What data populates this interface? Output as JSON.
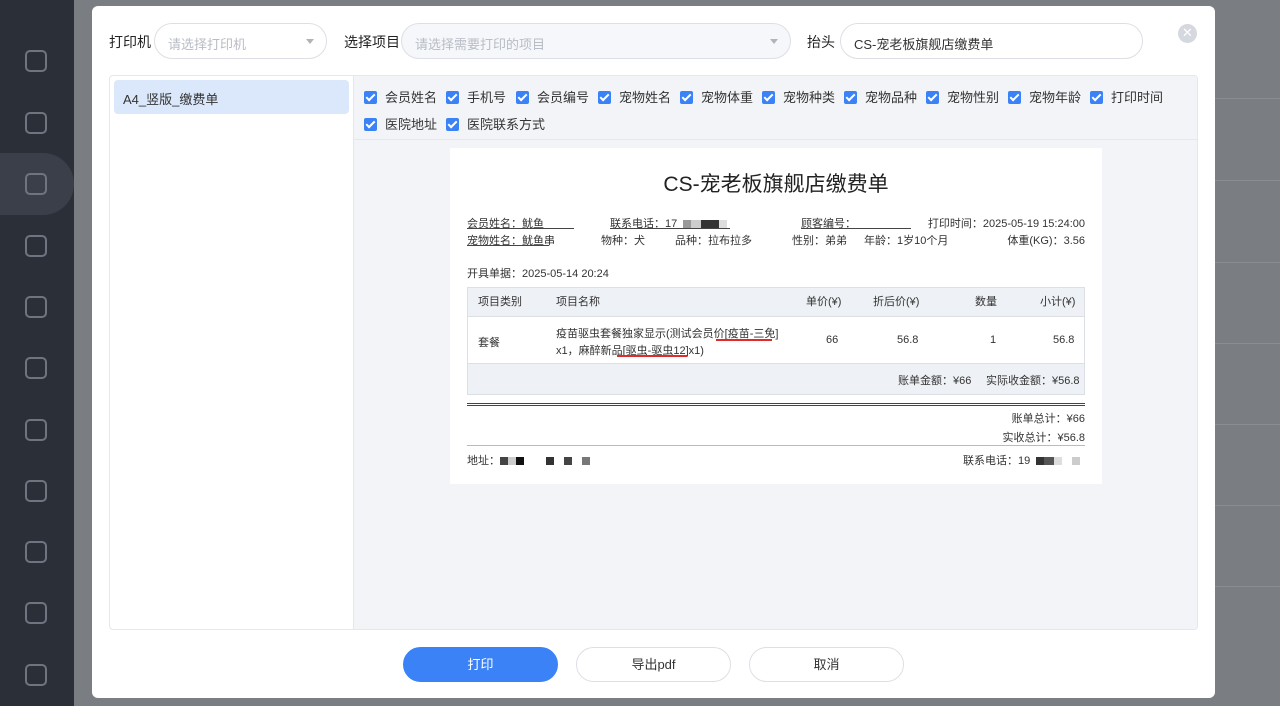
{
  "modal": {
    "printer_label": "打印机",
    "printer_placeholder": "请选择打印机",
    "project_label": "选择项目",
    "project_placeholder": "请选择需要打印的项目",
    "header_label": "抬头",
    "header_value": "CS-宠老板旗舰店缴费单",
    "close_icon": "close-icon"
  },
  "templates": [
    {
      "label": "A4_竖版_缴费单",
      "selected": true
    }
  ],
  "fields": [
    {
      "label": "会员姓名",
      "checked": true
    },
    {
      "label": "手机号",
      "checked": true
    },
    {
      "label": "会员编号",
      "checked": true
    },
    {
      "label": "宠物姓名",
      "checked": true
    },
    {
      "label": "宠物体重",
      "checked": true
    },
    {
      "label": "宠物种类",
      "checked": true
    },
    {
      "label": "宠物品种",
      "checked": true
    },
    {
      "label": "宠物性别",
      "checked": true
    },
    {
      "label": "宠物年龄",
      "checked": true
    },
    {
      "label": "打印时间",
      "checked": true
    },
    {
      "label": "医院地址",
      "checked": true
    },
    {
      "label": "医院联系方式",
      "checked": true
    }
  ],
  "receipt": {
    "title": "CS-宠老板旗舰店缴费单",
    "member_name": "会员姓名：鱿鱼",
    "contact_phone": "联系电话：17",
    "customer_no": "顾客编号：",
    "print_time": "打印时间：2025-05-19 15:24:00",
    "pet_name": "宠物姓名：鱿鱼串",
    "species": "物种：犬",
    "breed": "品种：拉布拉多",
    "gender": "性别：弟弟",
    "age": "年龄：1岁10个月",
    "weight": "体重(KG)：3.56",
    "issue_date": "开具单据：2025-05-14 20:24",
    "table_headers": [
      "项目类别",
      "项目名称",
      "单价(¥)",
      "折后价(¥)",
      "数量",
      "小计(¥)"
    ],
    "row": {
      "category": "套餐",
      "name_line1": "疫苗驱虫套餐独家显示(测试会员价[疫苗-三免]",
      "name_line2": "x1，麻醉新品[驱虫-驱虫12]x1)",
      "price": "66",
      "discount_price": "56.8",
      "qty": "1",
      "subtotal": "56.8"
    },
    "bill_amount": "账单金额：¥66",
    "actual_amount": "实际收金额：¥56.8",
    "bill_total": "账单总计：¥66",
    "actual_total": "实收总计：¥56.8",
    "address": "地址：",
    "hospital_phone": "联系电话：19"
  },
  "buttons": {
    "print": "打印",
    "export_pdf": "导出pdf",
    "cancel": "取消"
  }
}
